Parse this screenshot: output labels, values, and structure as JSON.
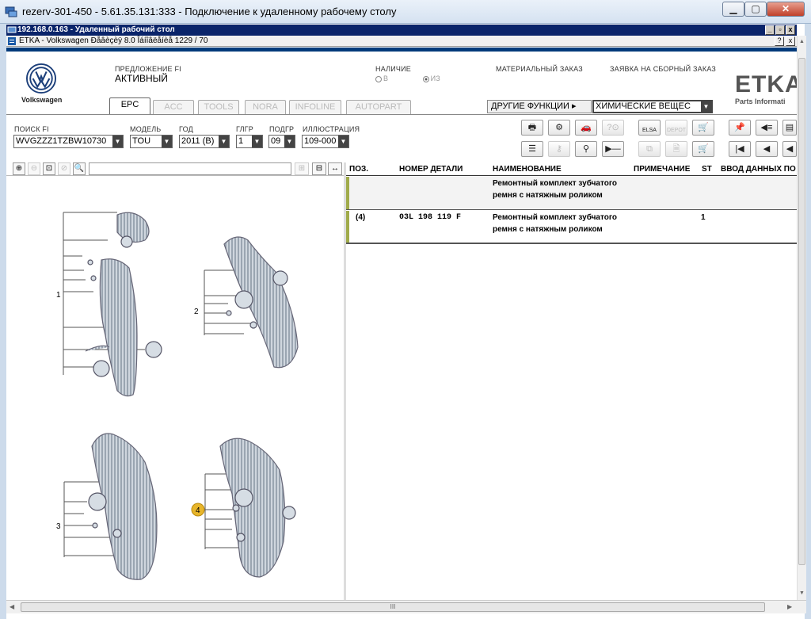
{
  "window": {
    "title": "rezerv-301-450 - 5.61.35.131:333 - Подключение к удаленному рабочему столу"
  },
  "rdp_bar": {
    "title": "192.168.0.163 - Удаленный рабочий стол"
  },
  "app_bar": {
    "title": "ETKA - Volkswagen Ðåâèçèÿ 8.0 Îáíîâëåíèå 1229 / 70"
  },
  "brand": {
    "logo_text": "Volkswagen",
    "etka": "ETKA",
    "etka_sub": "Parts Informati"
  },
  "proposal": {
    "label": "ПРЕДЛОЖЕНИЕ FI",
    "value": "АКТИВНЫЙ"
  },
  "availability": {
    "label": "НАЛИЧИЕ",
    "opt_in": "В",
    "opt_from": "ИЗ",
    "selected": "ИЗ"
  },
  "material_order": "МАТЕРИАЛЬНЫЙ ЗАКАЗ",
  "assembly_order": "ЗАЯВКА НА СБОРНЫЙ ЗАКАЗ",
  "tabs": [
    "EPC",
    "ACC",
    "TOOLS",
    "NORA",
    "INFOLINE",
    "AUTOPART"
  ],
  "active_tab": "EPC",
  "other_functions": "ДРУГИЕ ФУНКЦИИ ▸",
  "chemicals": "ХИМИЧЕСКИЕ ВЕЩЕС",
  "filters": {
    "search_fi": {
      "label": "ПОИСК FI",
      "value": "WVGZZZ1TZBW10730"
    },
    "model": {
      "label": "МОДЕЛЬ",
      "value": "TOU"
    },
    "year": {
      "label": "ГОД",
      "value": "2011 (B)"
    },
    "glgr": {
      "label": "ГЛГР",
      "value": "1"
    },
    "podgr": {
      "label": "ПОДГР",
      "value": "09"
    },
    "illustration": {
      "label": "ИЛЛЮСТРАЦИЯ",
      "value": "109-000"
    }
  },
  "toolbar": {
    "elsa": "ELSA",
    "depot": "DEPOT"
  },
  "table": {
    "headers": {
      "pos": "ПОЗ.",
      "part_no": "НОМЕР ДЕТАЛИ",
      "name": "НАИМЕНОВАНИЕ",
      "note": "ПРИМЕЧАНИЕ",
      "st": "ST",
      "input": "ВВОД ДАННЫХ ПО"
    },
    "rows": [
      {
        "pos": "",
        "part_no": "",
        "name_line1": "Ремонтный комплект зубчатого",
        "name_line2": "ремня с натяжным роликом",
        "note": "",
        "st": ""
      },
      {
        "pos": "(4)",
        "part_no": "03L 198 119 F",
        "name_line1": "Ремонтный комплект зубчатого",
        "name_line2": "ремня с натяжным роликом",
        "note": "",
        "st": "1"
      }
    ]
  },
  "diagram": {
    "callouts": [
      "1",
      "2",
      "3",
      "4"
    ],
    "highlighted": "4"
  },
  "hscroll_label": "III"
}
